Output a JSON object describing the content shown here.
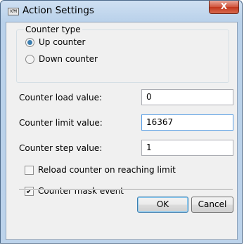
{
  "window": {
    "title": "Action Settings",
    "icon": "app-window-icon",
    "icon_text": "KPM",
    "close_glyph": "X"
  },
  "counter_type": {
    "legend": "Counter type",
    "options": [
      {
        "label": "Up counter",
        "selected": true
      },
      {
        "label": "Down counter",
        "selected": false
      }
    ]
  },
  "fields": {
    "load": {
      "label": "Counter load value:",
      "value": "0"
    },
    "limit": {
      "label": "Counter limit value:",
      "value": "16367"
    },
    "step": {
      "label": "Counter step value:",
      "value": "1"
    }
  },
  "options": {
    "reload": {
      "label": "Reload counter on reaching limit",
      "checked": false
    },
    "mask": {
      "label": "Counter mask event",
      "checked": true,
      "glyph": "✔"
    }
  },
  "buttons": {
    "ok": "OK",
    "cancel": "Cancel"
  },
  "colors": {
    "titlebar": "#b9d1ea",
    "close_button": "#c2361c",
    "focus_border": "#569de5"
  }
}
